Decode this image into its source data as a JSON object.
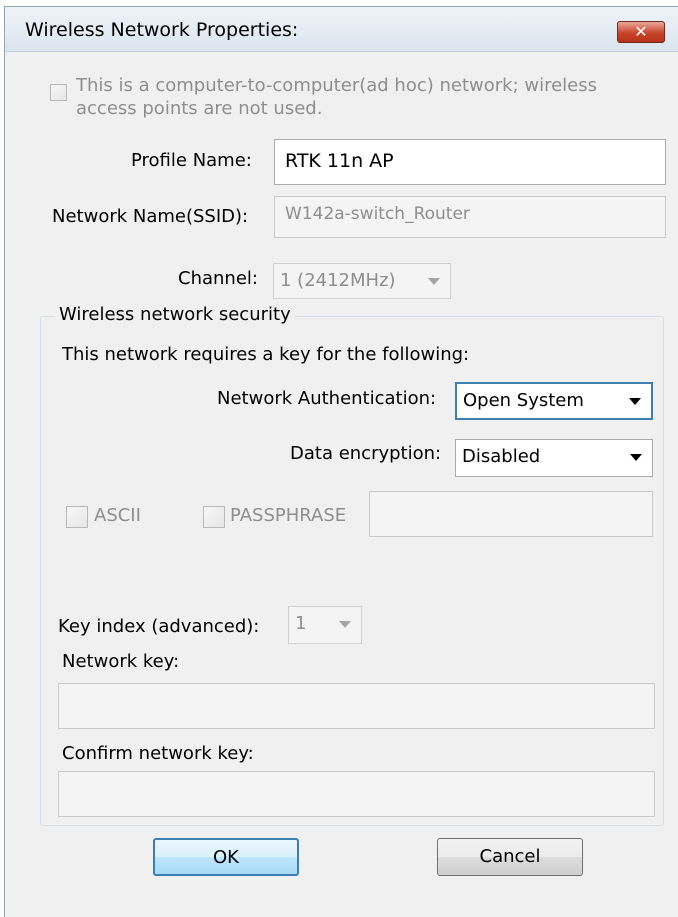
{
  "window": {
    "title": "Wireless Network Properties:",
    "close_glyph": "✕"
  },
  "adhoc": {
    "line1": "This is a computer-to-computer(ad hoc) network; wireless",
    "line2": "access points are not used."
  },
  "profile": {
    "label": "Profile Name:",
    "value": "RTK 11n AP"
  },
  "ssid": {
    "label": "Network Name(SSID):",
    "value": "W142a-switch_Router"
  },
  "channel": {
    "label": "Channel:",
    "value": "1  (2412MHz)"
  },
  "security": {
    "group_title": "Wireless network security",
    "requires_text": "This network requires a key for the following:",
    "auth_label": "Network Authentication:",
    "auth_value": "Open System",
    "enc_label": "Data encryption:",
    "enc_value": "Disabled",
    "ascii_label": "ASCII",
    "passphrase_label": "PASSPHRASE",
    "passphrase_value": "",
    "key_index_label": "Key index (advanced):",
    "key_index_value": "1",
    "network_key_label": "Network key:",
    "network_key_value": "",
    "confirm_key_label": "Confirm network key:",
    "confirm_key_value": ""
  },
  "buttons": {
    "ok": "OK",
    "cancel": "Cancel"
  }
}
